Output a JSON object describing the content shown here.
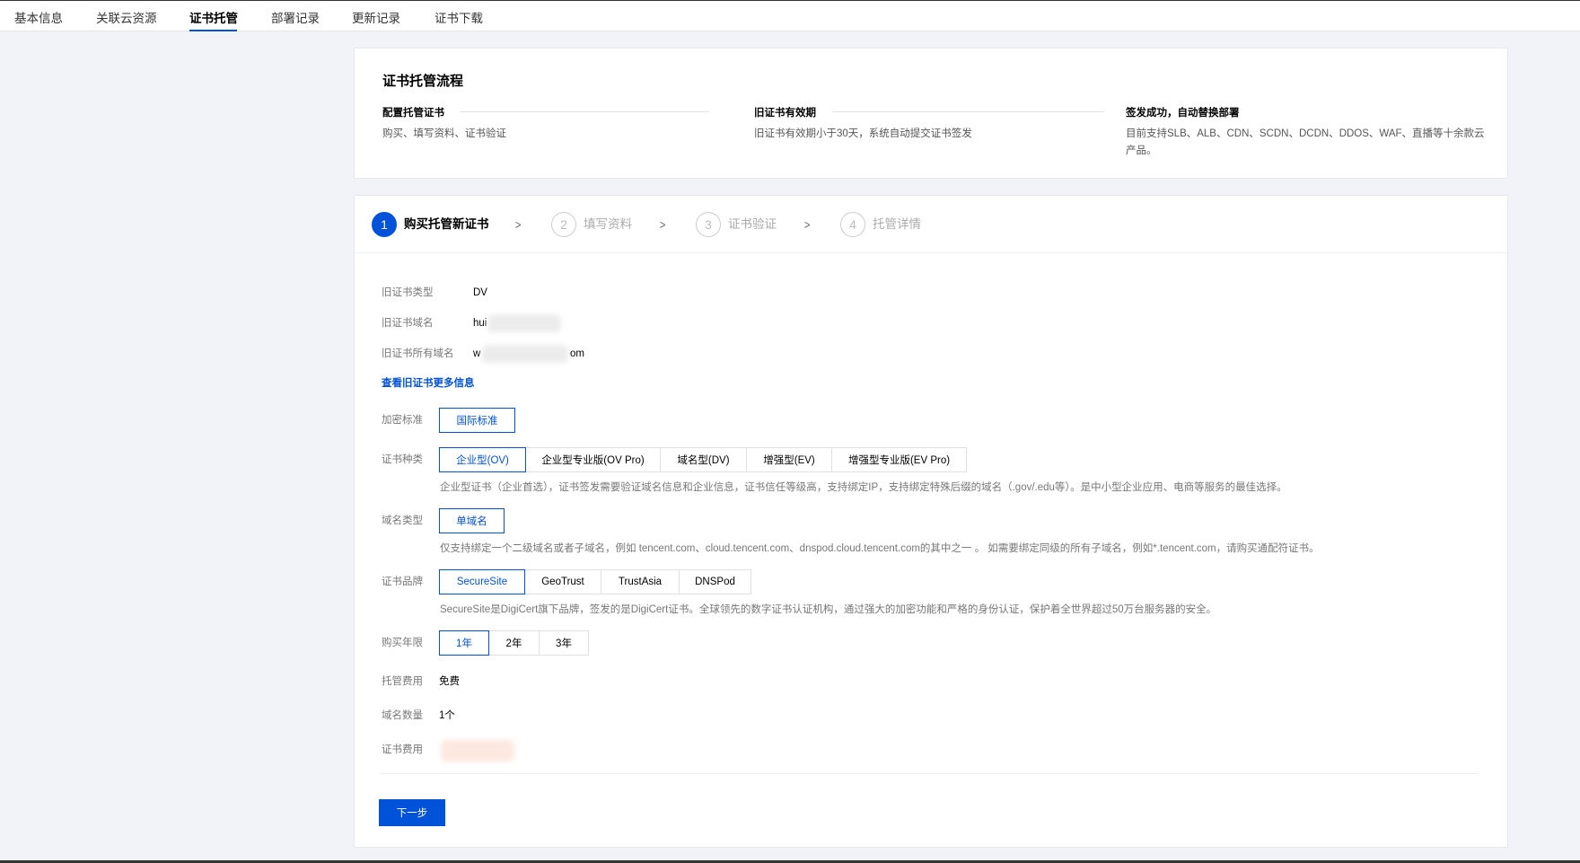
{
  "tabs": [
    {
      "label": "基本信息"
    },
    {
      "label": "关联云资源"
    },
    {
      "label": "证书托管"
    },
    {
      "label": "部署记录"
    },
    {
      "label": "更新记录"
    },
    {
      "label": "证书下载"
    }
  ],
  "flow": {
    "title": "证书托管流程",
    "steps": [
      {
        "title": "配置托管证书",
        "desc": "购买、填写资料、证书验证"
      },
      {
        "title": "旧证书有效期",
        "desc": "旧证书有效期小于30天，系统自动提交证书签发"
      },
      {
        "title": "签发成功，自动替换部署",
        "desc": "目前支持SLB、ALB、CDN、SCDN、DCDN、DDOS、WAF、直播等十余款云产品。"
      }
    ]
  },
  "wizard": {
    "steps": [
      {
        "num": "1",
        "label": "购买托管新证书"
      },
      {
        "num": "2",
        "label": "填写资料"
      },
      {
        "num": "3",
        "label": "证书验证"
      },
      {
        "num": "4",
        "label": "托管详情"
      }
    ]
  },
  "old_cert": {
    "type_label": "旧证书类型",
    "type_value": "DV",
    "domain_label": "旧证书域名",
    "domain_value": "hui",
    "all_label": "旧证书所有域名",
    "all_value_start": "w",
    "all_value_end": "om",
    "more_link": "查看旧证书更多信息"
  },
  "form": {
    "encryption": {
      "label": "加密标准",
      "options": [
        "国际标准"
      ],
      "selected": 0
    },
    "cert_kind": {
      "label": "证书种类",
      "options": [
        "企业型(OV)",
        "企业型专业版(OV Pro)",
        "域名型(DV)",
        "增强型(EV)",
        "增强型专业版(EV Pro)"
      ],
      "selected": 0,
      "hint": "企业型证书（企业首选），证书签发需要验证域名信息和企业信息，证书信任等级高，支持绑定IP，支持绑定特殊后缀的域名（.gov/.edu等）。是中小型企业应用、电商等服务的最佳选择。"
    },
    "domain_type": {
      "label": "域名类型",
      "options": [
        "单域名"
      ],
      "selected": 0,
      "hint": "仅支持绑定一个二级域名或者子域名，例如 tencent.com、cloud.tencent.com、dnspod.cloud.tencent.com的其中之一 。 如需要绑定同级的所有子域名，例如*.tencent.com，请购买通配符证书。"
    },
    "brand": {
      "label": "证书品牌",
      "options": [
        "SecureSite",
        "GeoTrust",
        "TrustAsia",
        "DNSPod"
      ],
      "selected": 0,
      "hint": "SecureSite是DigiCert旗下品牌，签发的是DigiCert证书。全球领先的数字证书认证机构，通过强大的加密功能和严格的身份认证，保护着全世界超过50万台服务器的安全。"
    },
    "years": {
      "label": "购买年限",
      "options": [
        "1年",
        "2年",
        "3年"
      ],
      "selected": 0
    },
    "hosting_fee": {
      "label": "托管费用",
      "value": "免费"
    },
    "domain_count": {
      "label": "域名数量",
      "value": "1个"
    },
    "cert_fee": {
      "label": "证书费用"
    }
  },
  "next_button": "下一步",
  "colors": {
    "primary": "#0052d9",
    "background": "#f2f3f8"
  }
}
